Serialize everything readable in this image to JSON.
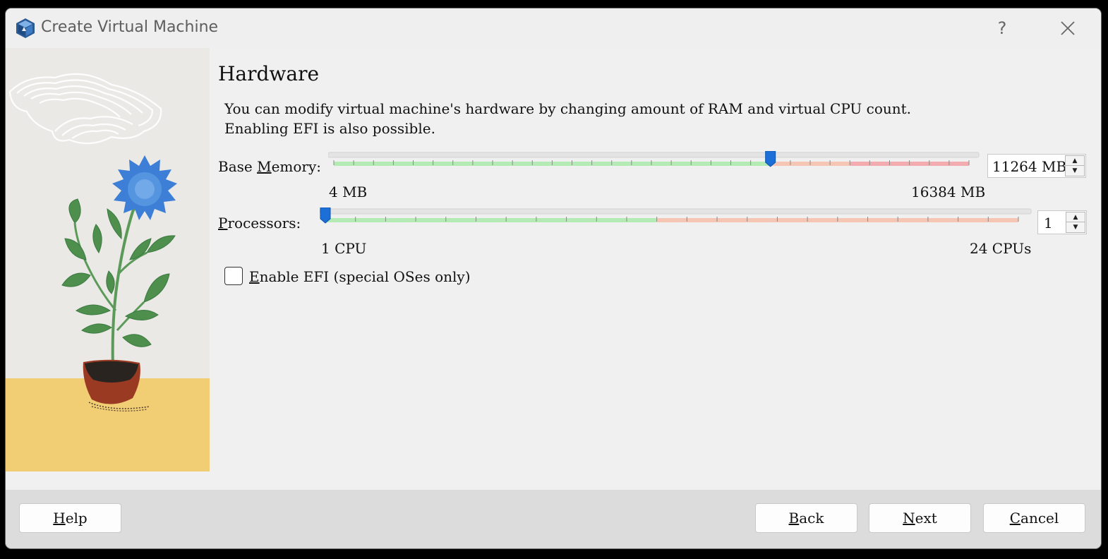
{
  "window": {
    "title": "Create Virtual Machine",
    "help_glyph": "?",
    "close_glyph": "✕"
  },
  "page": {
    "heading": "Hardware",
    "description": "You can modify virtual machine's hardware by changing amount of RAM and virtual CPU count.\nEnabling EFI is also possible."
  },
  "memory": {
    "label": "Base Memory:",
    "mnemonic": "M",
    "min_label": "4 MB",
    "max_label": "16384 MB",
    "value_text": "11264 MB",
    "min": 4,
    "max": 16384,
    "value": 11264,
    "tick_count": 32,
    "recommended_limit": 11264,
    "warning_limit": 13312
  },
  "processors": {
    "label": "Processors:",
    "mnemonic": "P",
    "min_label": "1 CPU",
    "max_label": "24 CPUs",
    "value_text": "1",
    "min": 1,
    "max": 24,
    "value": 1,
    "tick_count": 23,
    "recommended_limit": 12
  },
  "efi": {
    "label": "Enable EFI (special OSes only)",
    "checked": false
  },
  "buttons": {
    "help": "Help",
    "back": "Back",
    "next": "Next",
    "cancel": "Cancel"
  },
  "colors": {
    "accent": "#1c6fd6",
    "track_ok": "#b4ebb4",
    "track_warn": "#f5c6b3",
    "track_bad": "#f2abaf",
    "illustration_wall": "#ebe9e6",
    "illustration_floor": "#f1cd73"
  }
}
